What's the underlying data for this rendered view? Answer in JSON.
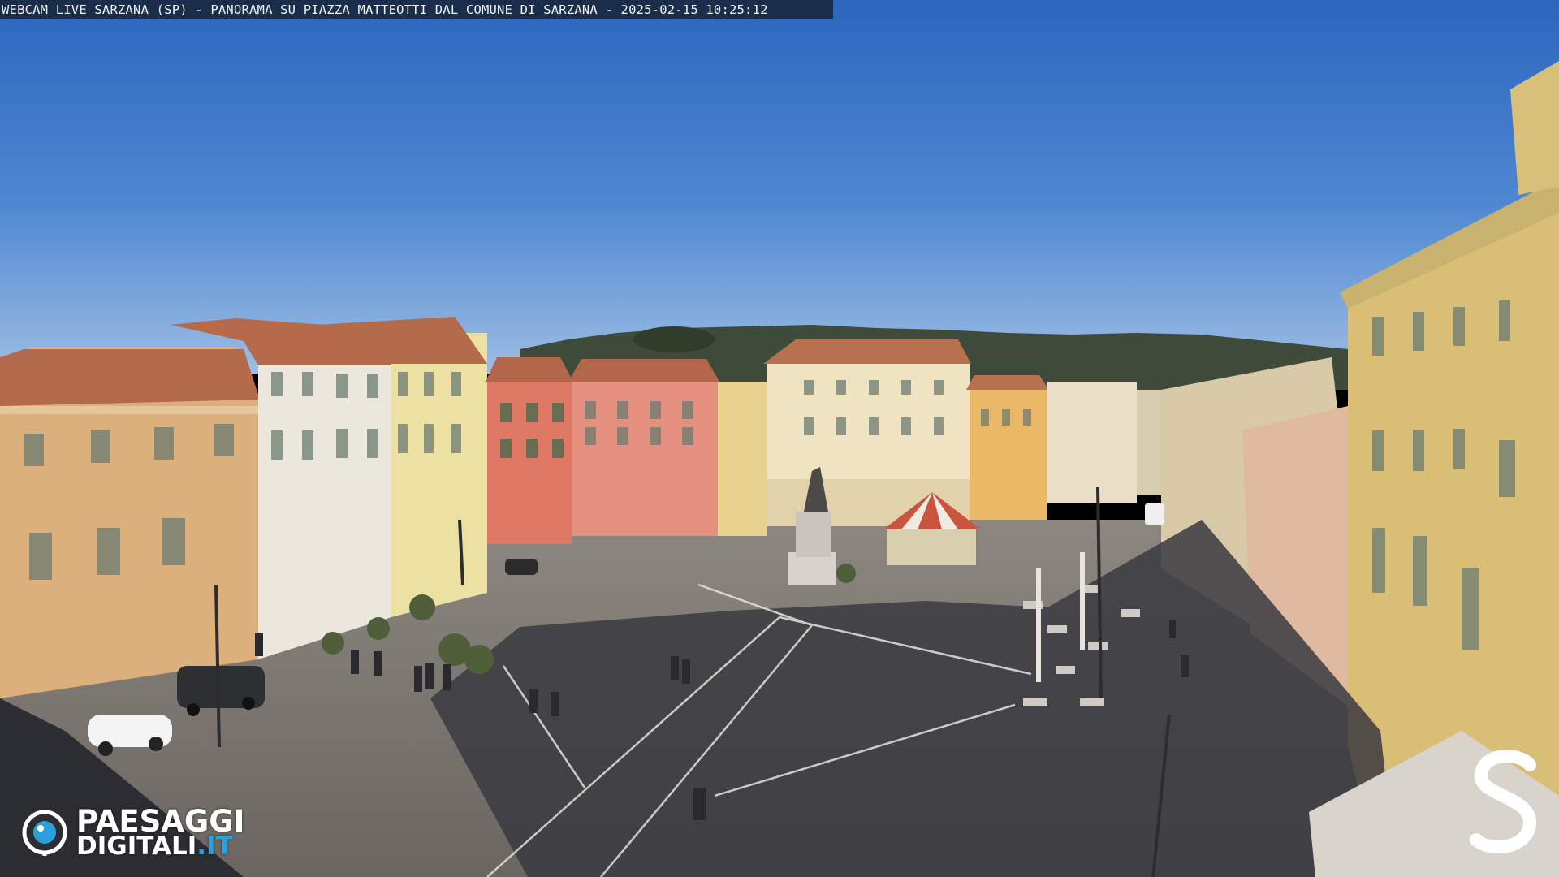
{
  "overlay": {
    "title": "WEBCAM LIVE SARZANA (SP) - PANORAMA SU PIAZZA MATTEOTTI DAL COMUNE DI SARZANA - 2025-02-15  10:25:12"
  },
  "logo": {
    "line1": "PAESAGGI",
    "line2_main": "DIGITALI",
    "line2_tld": ".IT",
    "accent_color": "#2aa0dc",
    "icon": "eye-camera-icon"
  },
  "corner_mark": {
    "letter": "S",
    "icon": "letter-s-mark"
  },
  "colors": {
    "sky_top": "#2f6fc4",
    "sky_bottom": "#8fb4e0",
    "pavement": "#5d5a57",
    "shadow": "#2c2d33"
  }
}
